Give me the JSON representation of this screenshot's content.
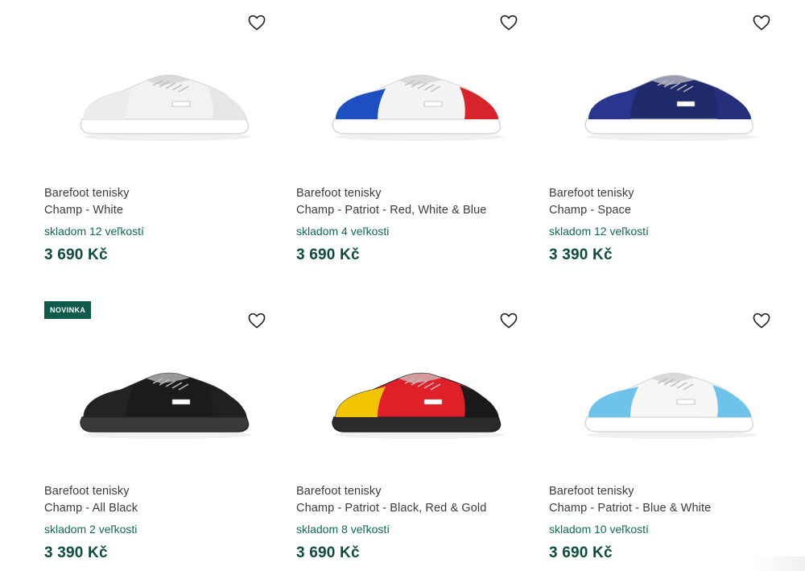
{
  "products": [
    {
      "line1": "Barefoot tenisky",
      "line2": "Champ - White",
      "stock": "skladom 12 veľkostí",
      "price": "3 690 Kč",
      "badge": "",
      "colors": {
        "upper": "#f2f2f2",
        "toe": "#ececec",
        "heel": "#e6e6e6",
        "sole": "#ffffff",
        "edge": "#d7d7d7"
      }
    },
    {
      "line1": "Barefoot tenisky",
      "line2": "Champ - Patriot - Red, White & Blue",
      "stock": "skladom 4 veľkosti",
      "price": "3 690 Kč",
      "badge": "",
      "colors": {
        "upper": "#f4f4f4",
        "toe": "#1e4fc2",
        "heel": "#d8232a",
        "sole": "#ffffff",
        "edge": "#d7d7d7"
      }
    },
    {
      "line1": "Barefoot tenisky",
      "line2": "Champ - Space",
      "stock": "skladom 12 veľkostí",
      "price": "3 390 Kč",
      "badge": "",
      "colors": {
        "upper": "#1f2a6b",
        "toe": "#2a3590",
        "heel": "#252f7c",
        "sole": "#ffffff",
        "edge": "#d7d7d7"
      }
    },
    {
      "line1": "Barefoot tenisky",
      "line2": "Champ - All Black",
      "stock": "skladom 2 veľkosti",
      "price": "3 390 Kč",
      "badge": "NOVINKA",
      "colors": {
        "upper": "#1b1b1b",
        "toe": "#232323",
        "heel": "#202020",
        "sole": "#3a3a3a",
        "edge": "#2a2a2a"
      }
    },
    {
      "line1": "Barefoot tenisky",
      "line2": "Champ - Patriot - Black, Red & Gold",
      "stock": "skladom 8 veľkostí",
      "price": "3 690 Kč",
      "badge": "",
      "colors": {
        "upper": "#e02028",
        "toe": "#f2c300",
        "heel": "#1a1a1a",
        "sole": "#2b2b2b",
        "edge": "#1f1f1f"
      }
    },
    {
      "line1": "Barefoot tenisky",
      "line2": "Champ - Patriot - Blue & White",
      "stock": "skladom 10 veľkostí",
      "price": "3 690 Kč",
      "badge": "",
      "colors": {
        "upper": "#f6f6f6",
        "toe": "#6ec3ea",
        "heel": "#6ec3ea",
        "sole": "#ffffff",
        "edge": "#d7d7d7"
      }
    }
  ],
  "icons": {
    "favorite": "heart-outline-icon"
  },
  "theme": {
    "accent": "#0f5a4a",
    "price": "#0d4c3e",
    "stock": "#0f6a52"
  }
}
